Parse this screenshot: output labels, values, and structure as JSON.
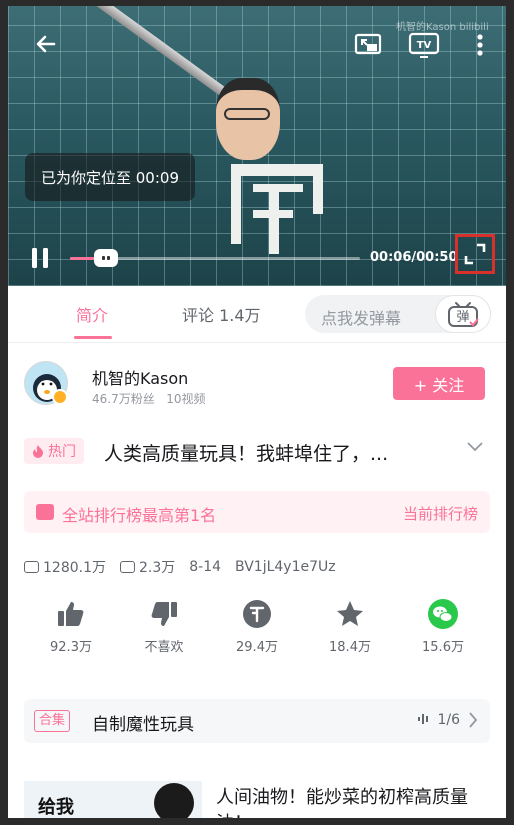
{
  "player": {
    "toast": "已为你定位至 00:09",
    "time": "00:06/00:50",
    "watermark": "机智的Kason bilibili",
    "progress_fraction": 0.12
  },
  "tabs": [
    {
      "label": "简介",
      "active": true
    },
    {
      "label": "评论 1.4万",
      "active": false
    }
  ],
  "danmaku": {
    "placeholder": "点我发弹幕",
    "toggle_label": "弹"
  },
  "uploader": {
    "name": "机智的Kason",
    "fans": "46.7万粉丝",
    "videos": "10视频",
    "follow_label": "+ 关注"
  },
  "video": {
    "hot_tag": "热门",
    "title": "人类高质量玩具！我蚌埠住了，...",
    "rank_text": "全站排行榜最高第1名",
    "rank_link": "当前排行榜",
    "views": "1280.1万",
    "danmaku_count": "2.3万",
    "date": "8-14",
    "bvid": "BV1jL4y1e7Uz"
  },
  "actions": [
    {
      "icon": "thumbs-up-icon",
      "label": "92.3万"
    },
    {
      "icon": "thumbs-down-icon",
      "label": "不喜欢"
    },
    {
      "icon": "coin-icon",
      "label": "29.4万"
    },
    {
      "icon": "star-icon",
      "label": "18.4万"
    },
    {
      "icon": "wechat-icon",
      "label": "15.6万"
    }
  ],
  "collection": {
    "tag": "合集",
    "name": "自制魔性玩具",
    "page": "1/6"
  },
  "recommend": {
    "thumb_text": "给我",
    "title": "人间油物！能炒菜的初榨高质量油！"
  },
  "colors": {
    "accent": "#fb7299",
    "highlight_box": "#d9302c"
  }
}
